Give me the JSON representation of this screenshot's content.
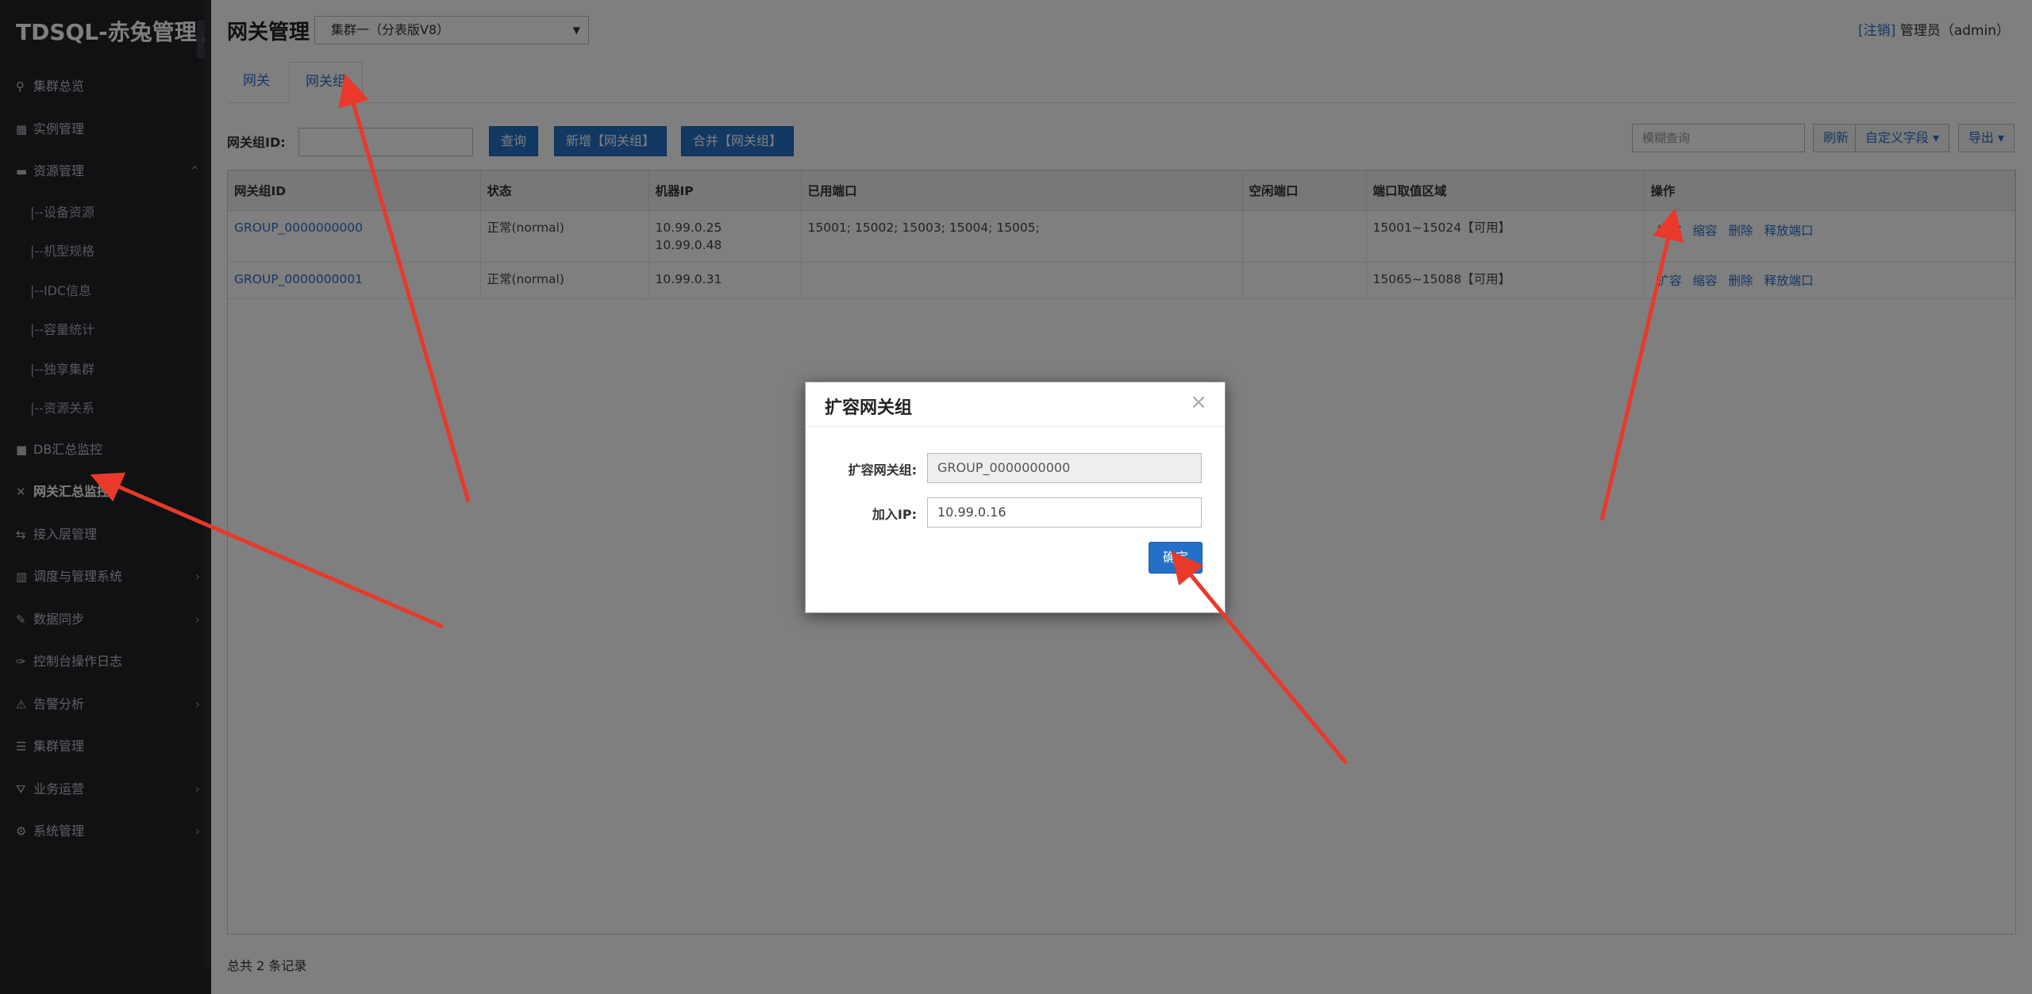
{
  "brand": "TDSQL-赤兔管理台",
  "sidebar": {
    "items": [
      {
        "icon": "search-icon",
        "glyph": "⚲",
        "label": "集群总览"
      },
      {
        "icon": "grid-icon",
        "glyph": "▦",
        "label": "实例管理"
      },
      {
        "icon": "server-icon",
        "glyph": "▬",
        "label": "资源管理",
        "chev": "⌃"
      },
      {
        "label": "|--设备资源"
      },
      {
        "label": "|--机型规格"
      },
      {
        "label": "|--IDC信息"
      },
      {
        "label": "|--容量统计"
      },
      {
        "label": "|--独享集群"
      },
      {
        "label": "|--资源关系"
      },
      {
        "icon": "db-icon",
        "glyph": "■",
        "label": "DB汇总监控"
      },
      {
        "icon": "shuffle-icon",
        "glyph": "✕",
        "label": "网关汇总监控"
      },
      {
        "icon": "access-icon",
        "glyph": "⇆",
        "label": "接入层管理"
      },
      {
        "icon": "modules-icon",
        "glyph": "▥",
        "label": "调度与管理系统",
        "chev": "›"
      },
      {
        "icon": "pen-icon",
        "glyph": "✎",
        "label": "数据同步",
        "chev": "›"
      },
      {
        "icon": "wrench-icon",
        "glyph": "✑",
        "label": "控制台操作日志"
      },
      {
        "icon": "warning-icon",
        "glyph": "⚠",
        "label": "告警分析",
        "chev": "›"
      },
      {
        "icon": "list-icon",
        "glyph": "☰",
        "label": "集群管理"
      },
      {
        "icon": "road-icon",
        "glyph": "⛛",
        "label": "业务运营",
        "chev": "›"
      },
      {
        "icon": "gear-icon",
        "glyph": "⚙",
        "label": "系统管理",
        "chev": "›"
      }
    ]
  },
  "header": {
    "title": "网关管理",
    "cluster": "集群一（分表版V8）",
    "logout": "[注销]",
    "user": "管理员（admin）"
  },
  "tabs": [
    "网关",
    "网关组"
  ],
  "filter": {
    "label": "网关组ID:",
    "query": "查询",
    "add": "新增【网关组】",
    "merge": "合并【网关组】",
    "search_placeholder": "模糊查询",
    "refresh": "刷新",
    "custom_fields": "自定义字段 ▾",
    "export": "导出 ▾"
  },
  "table": {
    "columns": [
      "网关组ID",
      "状态",
      "机器IP",
      "已用端口",
      "空闲端口",
      "端口取值区域",
      "操作"
    ],
    "rows": [
      {
        "id": "GROUP_0000000000",
        "status": "正常(normal)",
        "ip1": "10.99.0.25",
        "ip2": "10.99.0.48",
        "used": "15001; 15002; 15003; 15004; 15005;",
        "free": "",
        "range": "15001~15024【可用】"
      },
      {
        "id": "GROUP_0000000001",
        "status": "正常(normal)",
        "ip1": "10.99.0.31",
        "ip2": "",
        "used": "",
        "free": "",
        "range": "15065~15088【可用】"
      }
    ],
    "actions": [
      "扩容",
      "缩容",
      "删除",
      "释放端口"
    ]
  },
  "footer": "总共 2 条记录",
  "modal": {
    "title": "扩容网关组",
    "close": "×",
    "group_label": "扩容网关组:",
    "group_value": "GROUP_0000000000",
    "ip_label": "加入IP:",
    "ip_value": "10.99.0.16",
    "confirm": "确定"
  },
  "colors": {
    "accent": "#2470c9",
    "sidebar": "#1f2226",
    "arrow": "#e8392b"
  }
}
